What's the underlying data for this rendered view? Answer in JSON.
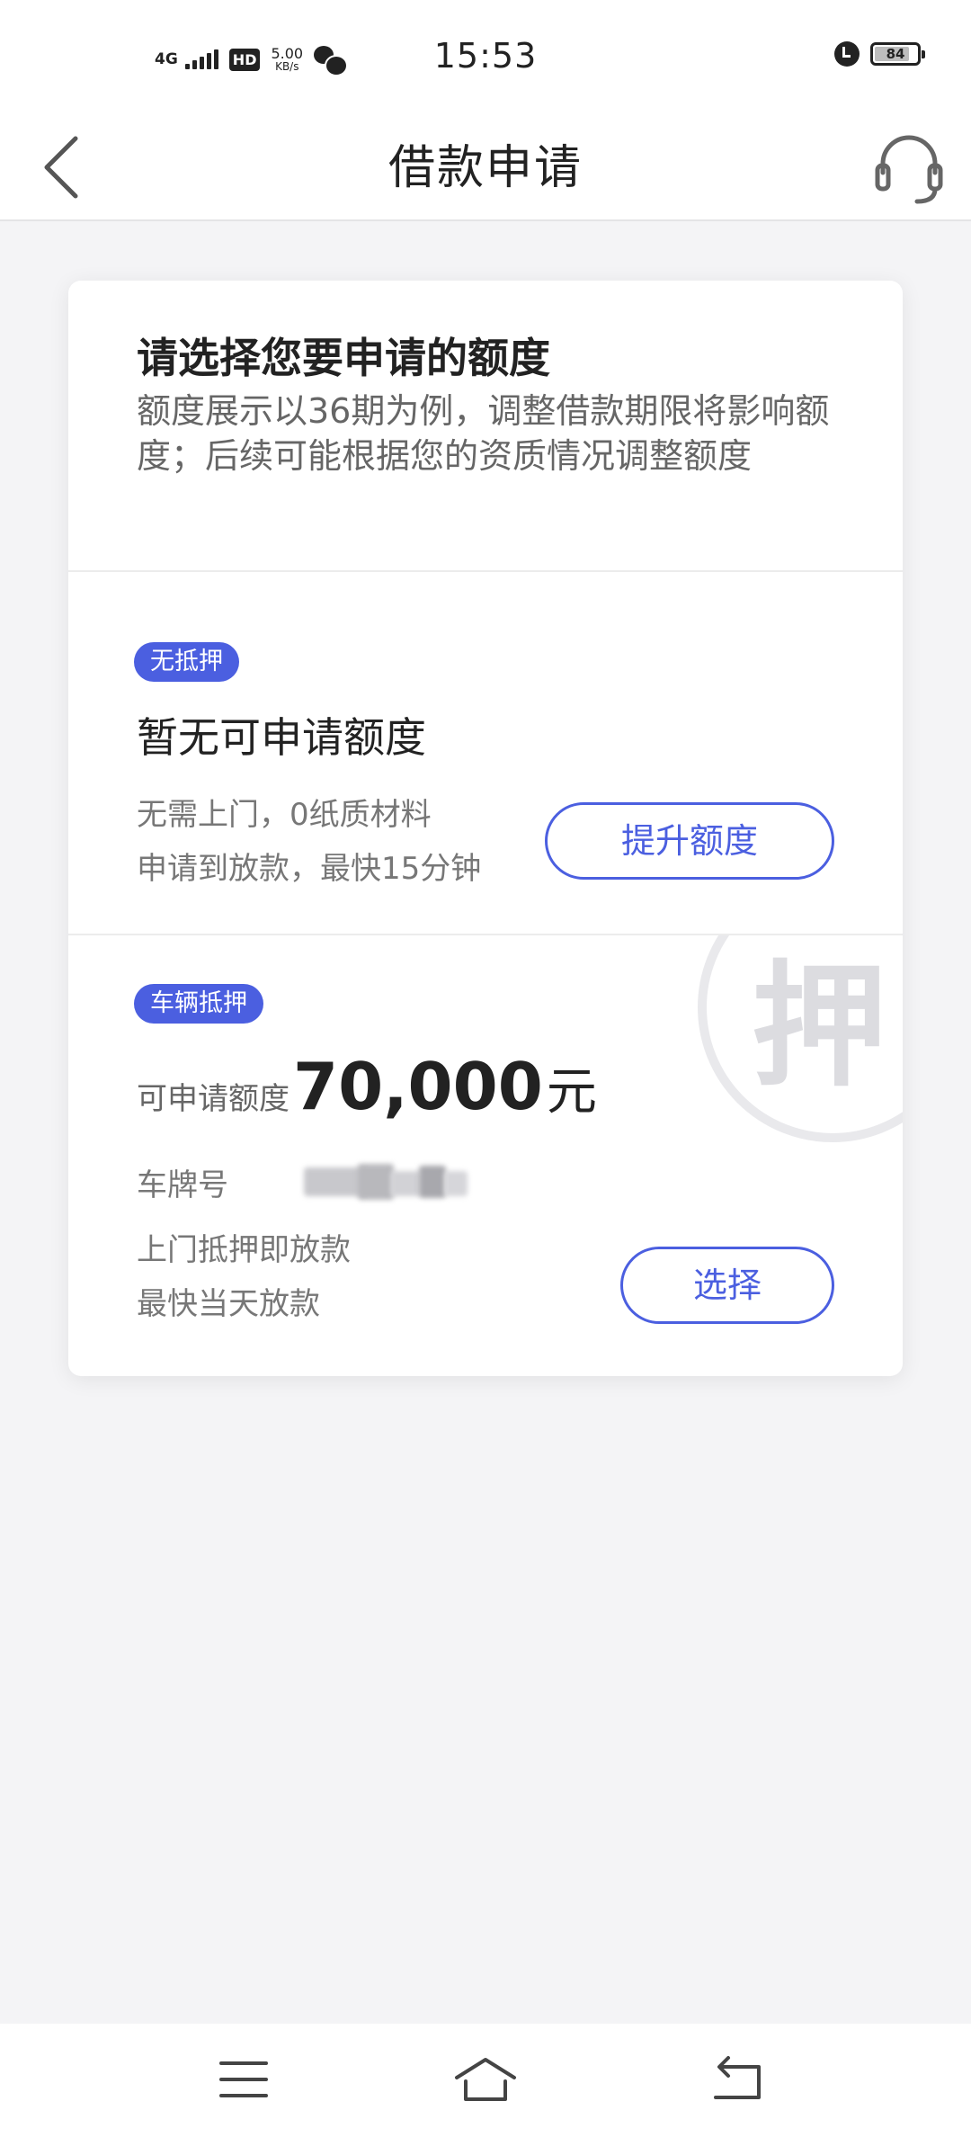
{
  "status_bar": {
    "network": "4G",
    "hd": "HD",
    "speed_value": "5.00",
    "speed_unit": "KB/s",
    "time": "15:53",
    "battery": "84"
  },
  "nav": {
    "title": "借款申请",
    "back_icon": "chevron-left-icon",
    "service_icon": "headset-icon"
  },
  "intro": {
    "heading": "请选择您要申请的额度",
    "description": "额度展示以36期为例，调整借款期限将影响额度；后续可能根据您的资质情况调整额度"
  },
  "unsecured": {
    "tag": "无抵押",
    "amount_text": "暂无可申请额度",
    "line1": "无需上门，0纸质材料",
    "line2": "申请到放款，最快15分钟",
    "button": "提升额度"
  },
  "vehicle": {
    "tag": "车辆抵押",
    "amount_label": "可申请额度",
    "amount": "70,000",
    "amount_unit": "元",
    "plate_label": "车牌号",
    "line1": "上门抵押即放款",
    "line2": "最快当天放款",
    "button": "选择",
    "watermark": "押"
  },
  "bottom_nav": [
    "menu-icon",
    "home-icon",
    "return-icon"
  ],
  "colors": {
    "accent": "#4b5fe0",
    "background": "#f4f4f6"
  }
}
